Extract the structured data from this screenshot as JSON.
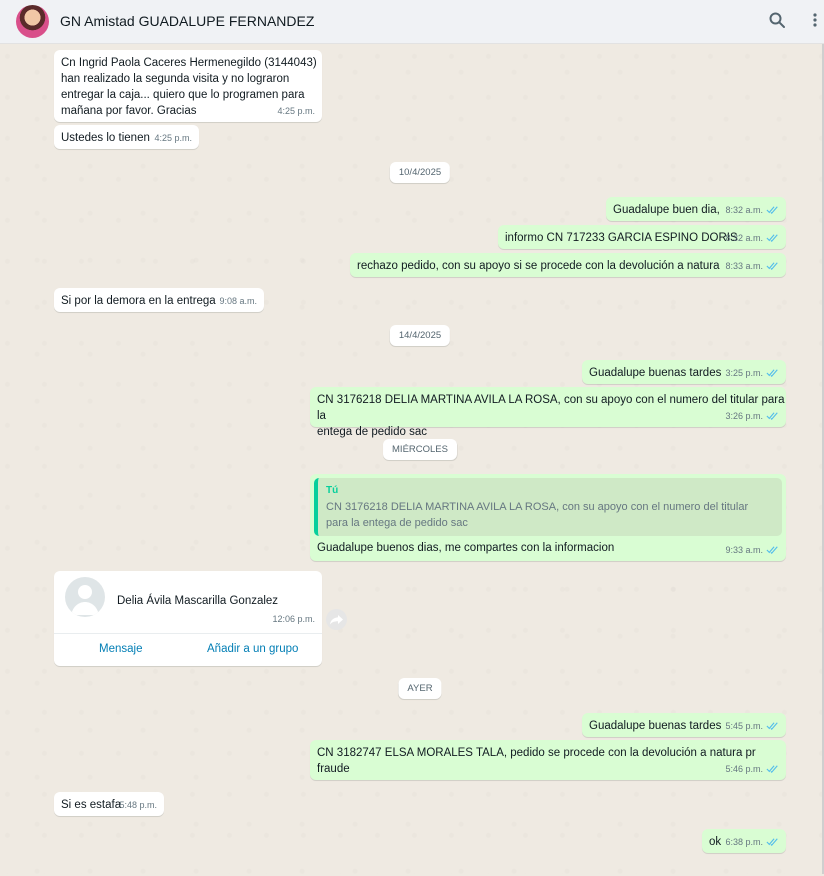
{
  "header": {
    "title": "GN Amistad GUADALUPE FERNANDEZ",
    "search_icon": "search-icon",
    "menu_icon": "more-vertical-icon"
  },
  "messages": [
    {
      "text": "Cn Ingrid Paola Caceres Hermenegildo (3144043)\nhan realizado la segunda visita y no lograron\nentregar la caja... quiero que lo programen para\nmañana por favor. Gracias",
      "time": "4:25 p.m."
    },
    {
      "text": "Ustedes lo tienen",
      "time": "4:25 p.m."
    },
    {
      "date": "10/4/2025"
    },
    {
      "text": "Guadalupe buen dia,",
      "time": "8:32 a.m."
    },
    {
      "text": "informo CN 717233 GARCIA ESPINO DORIS",
      "time": "8:32 a.m."
    },
    {
      "text": "rechazo pedido, con su apoyo si se procede con la devolución a natura",
      "time": "8:33 a.m."
    },
    {
      "text": "Si por la demora en la entrega",
      "time": "9:08 a.m."
    },
    {
      "date": "14/4/2025"
    },
    {
      "text": "Guadalupe buenas tardes",
      "time": "3:25 p.m."
    },
    {
      "text": "CN 3176218 DELIA MARTINA AVILA LA ROSA, con su apoyo con el numero del titular para la\nentega de pedido sac",
      "time": "3:26 p.m."
    },
    {
      "date": "MIÉRCOLES"
    },
    {
      "quote_author": "Tú",
      "quote_text": "CN 3176218 DELIA MARTINA AVILA LA ROSA, con su apoyo con el numero del titular\npara la entega de pedido sac",
      "text": "Guadalupe buenos dias, me compartes con la informacion",
      "time": "9:33 a.m."
    },
    {
      "contact_name": "Delia Ávila Mascarilla Gonzalez",
      "time": "12:06 p.m.",
      "action_message": "Mensaje",
      "action_add": "Añadir a un grupo"
    },
    {
      "date": "AYER"
    },
    {
      "text": "Guadalupe buenas tardes",
      "time": "5:45 p.m."
    },
    {
      "text": "CN 3182747 ELSA MORALES TALA, pedido se procede con la devolución a natura pr fraude",
      "time": "5:46 p.m."
    },
    {
      "text": "Si es estafa",
      "time": "5:48 p.m."
    },
    {
      "text": "ok",
      "time": "6:38 p.m."
    }
  ],
  "colors": {
    "chat_bg": "#efeae2",
    "incoming": "#ffffff",
    "outgoing": "#d9fdd3",
    "read_ticks": "#53bdeb",
    "link": "#027eb5"
  }
}
